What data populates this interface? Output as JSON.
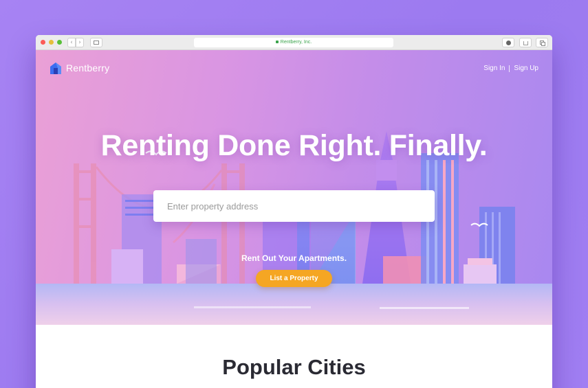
{
  "browser": {
    "url": "Rentberry, Inc.",
    "back_glyph": "‹",
    "forward_glyph": "›",
    "icons": [
      "sidebar-icon",
      "lock-icon",
      "download-icon",
      "share-icon",
      "tabs-icon"
    ]
  },
  "header": {
    "logo_text": "Rentberry",
    "sign_in": "Sign In",
    "sign_up": "Sign Up"
  },
  "hero": {
    "headline": "Renting Done Right. Finally.",
    "search_placeholder": "Enter property address",
    "rent_out_text": "Rent Out Your Apartments.",
    "list_button": "List a Property"
  },
  "main": {
    "section_title": "Popular Cities"
  },
  "colors": {
    "accent": "#f5a623",
    "logo_blue": "#3b6cf0",
    "hero_pink": "#eaa0d6",
    "hero_purple": "#a888f0",
    "page_bg": "#a783f3"
  }
}
